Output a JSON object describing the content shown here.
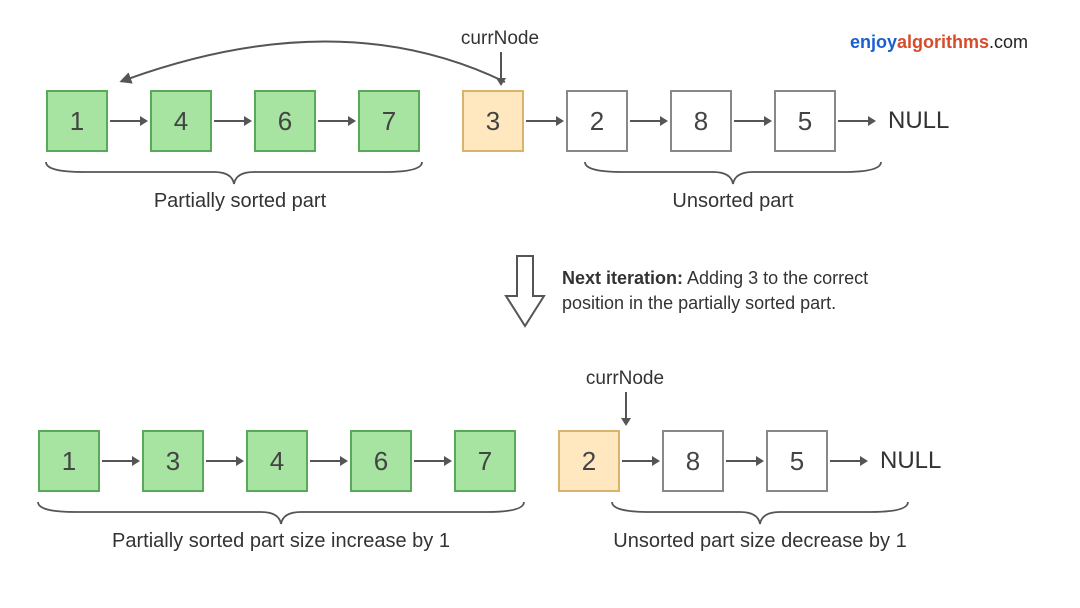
{
  "logo": {
    "part1": "enjoy",
    "part2": "algorithms",
    "part3": ".com"
  },
  "row1": {
    "currLabel": "currNode",
    "nodes": [
      "1",
      "4",
      "6",
      "7",
      "3",
      "2",
      "8",
      "5"
    ],
    "nullText": "NULL",
    "sortedLabel": "Partially sorted part",
    "unsortedLabel": "Unsorted part"
  },
  "transition": {
    "boldLabel": "Next iteration:",
    "text": " Adding 3 to the correct position in the partially sorted part."
  },
  "row2": {
    "currLabel": "currNode",
    "nodes": [
      "1",
      "3",
      "4",
      "6",
      "7",
      "2",
      "8",
      "5"
    ],
    "nullText": "NULL",
    "sortedLabel": "Partially sorted part size increase by 1",
    "unsortedLabel": "Unsorted part size decrease by 1"
  }
}
